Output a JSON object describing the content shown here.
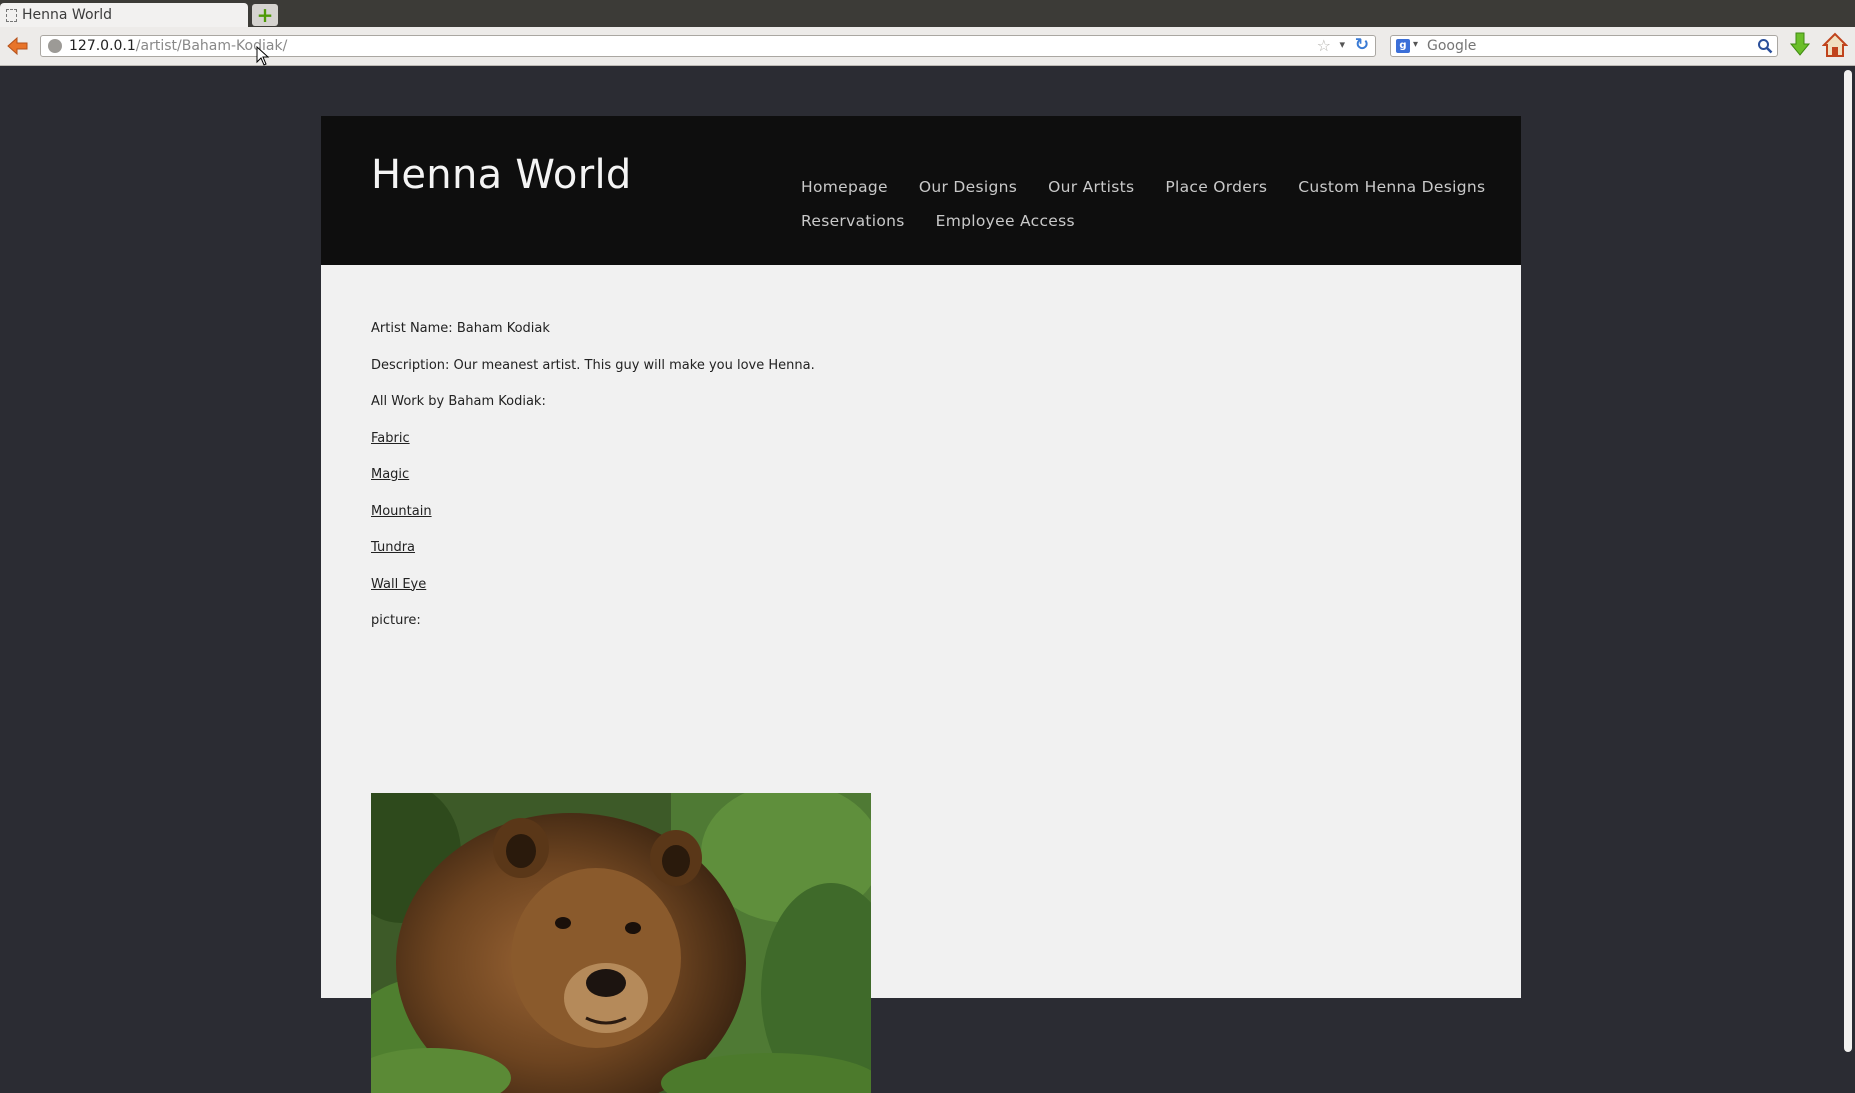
{
  "browser": {
    "tab_title": "Henna World",
    "new_tab_symbol": "+",
    "url_host": "127.0.0.1",
    "url_path": "/artist/Baham-Kodiak/",
    "search_placeholder": "Google",
    "search_engine_icon": "g-icon"
  },
  "site": {
    "title": "Henna World",
    "nav": [
      "Homepage",
      "Our Designs",
      "Our Artists",
      "Place Orders",
      "Custom Henna Designs",
      "Reservations",
      "Employee Access"
    ]
  },
  "artist": {
    "name_line": "Artist Name: Baham Kodiak",
    "description_line": "Description: Our meanest artist. This guy will make you love Henna.",
    "works_heading": "All Work by Baham Kodiak:",
    "works": [
      "Fabric",
      "Magic",
      "Mountain",
      "Tundra",
      "Wall Eye"
    ],
    "picture_label": "picture:"
  },
  "colors": {
    "header_bg": "#0e0e0e",
    "page_bg": "#2b2c33",
    "content_bg": "#f1f1f1"
  }
}
